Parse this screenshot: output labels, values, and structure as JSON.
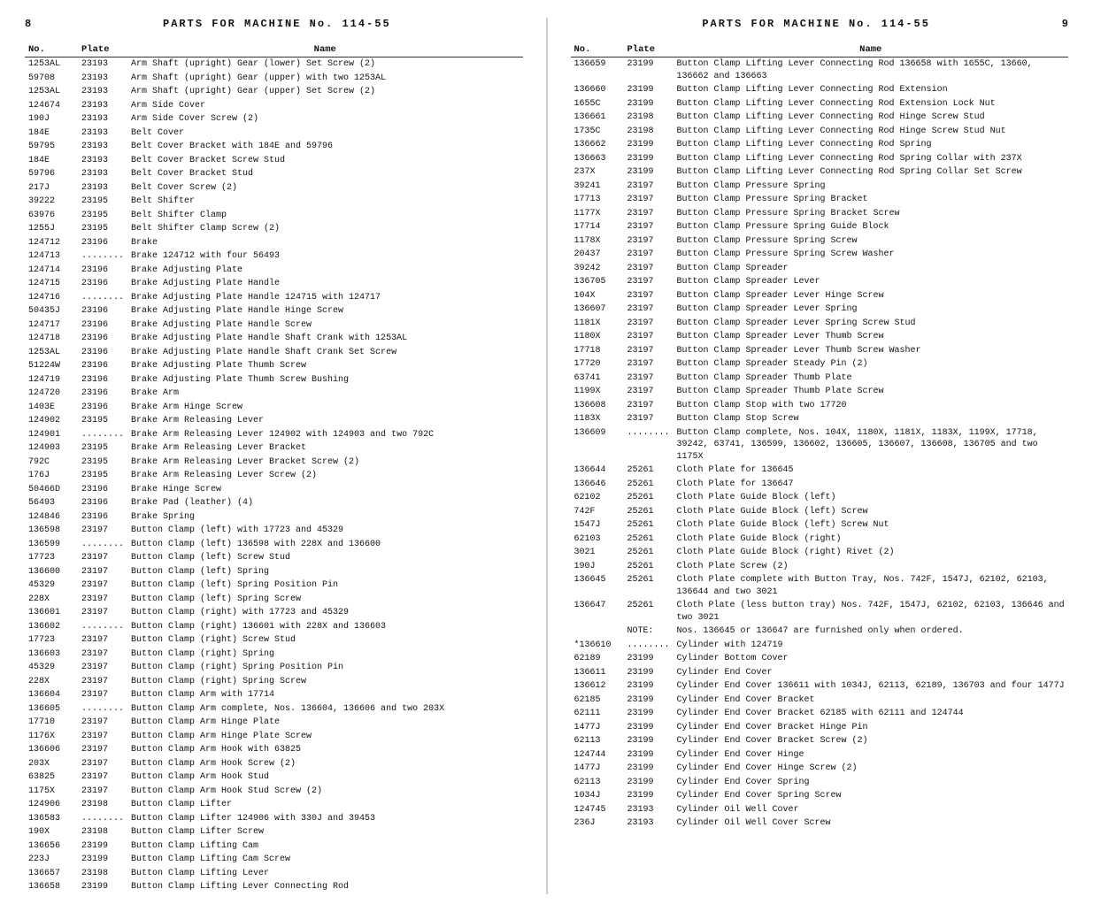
{
  "left_page": {
    "page_num": "8",
    "title": "PARTS  FOR  MACHINE  No.  114-55",
    "columns": [
      "No.",
      "Plate",
      "Name"
    ],
    "rows": [
      [
        "1253AL",
        "23193",
        "Arm Shaft (upright) Gear (lower) Set Screw (2)"
      ],
      [
        "59708",
        "23193",
        "Arm Shaft (upright) Gear (upper) with two 1253AL"
      ],
      [
        "1253AL",
        "23193",
        "Arm Shaft (upright) Gear (upper) Set Screw (2)"
      ],
      [
        "124674",
        "23193",
        "Arm Side Cover"
      ],
      [
        "190J",
        "23193",
        "Arm Side Cover Screw (2)"
      ],
      [
        "184E",
        "23193",
        "Belt Cover"
      ],
      [
        "59795",
        "23193",
        "Belt Cover Bracket with 184E and 59796"
      ],
      [
        "184E",
        "23193",
        "Belt Cover Bracket Screw Stud"
      ],
      [
        "59796",
        "23193",
        "Belt Cover Bracket Stud"
      ],
      [
        "217J",
        "23193",
        "Belt Cover Screw (2)"
      ],
      [
        "39222",
        "23195",
        "Belt Shifter"
      ],
      [
        "63976",
        "23195",
        "Belt Shifter Clamp"
      ],
      [
        "1255J",
        "23195",
        "Belt Shifter Clamp Screw (2)"
      ],
      [
        "124712",
        "23196",
        "Brake"
      ],
      [
        "124713",
        "........",
        "Brake 124712 with four 56493"
      ],
      [
        "124714",
        "23196",
        "Brake Adjusting Plate"
      ],
      [
        "124715",
        "23196",
        "Brake Adjusting Plate Handle"
      ],
      [
        "124716",
        "........",
        "Brake Adjusting Plate Handle 124715 with 124717"
      ],
      [
        "50435J",
        "23196",
        "Brake Adjusting Plate Handle Hinge Screw"
      ],
      [
        "124717",
        "23196",
        "Brake Adjusting Plate Handle Screw"
      ],
      [
        "124718",
        "23196",
        "Brake Adjusting Plate Handle Shaft Crank with 1253AL"
      ],
      [
        "1253AL",
        "23196",
        "Brake Adjusting Plate Handle Shaft Crank Set Screw"
      ],
      [
        "51224W",
        "23196",
        "Brake Adjusting Plate Thumb Screw"
      ],
      [
        "124719",
        "23196",
        "Brake Adjusting Plate Thumb Screw Bushing"
      ],
      [
        "124720",
        "23196",
        "Brake Arm"
      ],
      [
        "1403E",
        "23196",
        "Brake Arm Hinge Screw"
      ],
      [
        "124902",
        "23195",
        "Brake Arm Releasing Lever"
      ],
      [
        "124901",
        "........",
        "Brake Arm Releasing Lever 124902 with 124903 and two 792C"
      ],
      [
        "124903",
        "23195",
        "Brake Arm Releasing Lever Bracket"
      ],
      [
        "792C",
        "23195",
        "Brake Arm Releasing Lever Bracket Screw (2)"
      ],
      [
        "176J",
        "23195",
        "Brake Arm Releasing Lever Screw (2)"
      ],
      [
        "50466D",
        "23196",
        "Brake Hinge Screw"
      ],
      [
        "56493",
        "23196",
        "Brake Pad (leather) (4)"
      ],
      [
        "124846",
        "23196",
        "Brake Spring"
      ],
      [
        "136598",
        "23197",
        "Button Clamp (left) with 17723 and 45329"
      ],
      [
        "136599",
        "........",
        "Button Clamp (left) 136598 with 228X and 136600"
      ],
      [
        "17723",
        "23197",
        "Button Clamp (left) Screw Stud"
      ],
      [
        "136600",
        "23197",
        "Button Clamp (left) Spring"
      ],
      [
        "45329",
        "23197",
        "Button Clamp (left) Spring Position Pin"
      ],
      [
        "228X",
        "23197",
        "Button Clamp (left) Spring Screw"
      ],
      [
        "136601",
        "23197",
        "Button Clamp (right) with 17723 and 45329"
      ],
      [
        "136602",
        "........",
        "Button Clamp (right) 136601 with 228X and 136603"
      ],
      [
        "17723",
        "23197",
        "Button Clamp (right) Screw Stud"
      ],
      [
        "136603",
        "23197",
        "Button Clamp (right) Spring"
      ],
      [
        "45329",
        "23197",
        "Button Clamp (right) Spring Position Pin"
      ],
      [
        "228X",
        "23197",
        "Button Clamp (right) Spring Screw"
      ],
      [
        "136604",
        "23197",
        "Button Clamp Arm with 17714"
      ],
      [
        "136605",
        "........",
        "Button Clamp Arm complete, Nos. 136604, 136606 and two 203X"
      ],
      [
        "17710",
        "23197",
        "Button Clamp Arm Hinge Plate"
      ],
      [
        "1176X",
        "23197",
        "Button Clamp Arm Hinge Plate Screw"
      ],
      [
        "136606",
        "23197",
        "Button Clamp Arm Hook with 63825"
      ],
      [
        "203X",
        "23197",
        "Button Clamp Arm Hook Screw (2)"
      ],
      [
        "63825",
        "23197",
        "Button Clamp Arm Hook Stud"
      ],
      [
        "1175X",
        "23197",
        "Button Clamp Arm Hook Stud Screw (2)"
      ],
      [
        "124906",
        "23198",
        "Button Clamp Lifter"
      ],
      [
        "136583",
        "........",
        "Button Clamp Lifter 124906 with 330J and 39453"
      ],
      [
        "190X",
        "23198",
        "Button Clamp Lifter Screw"
      ],
      [
        "136656",
        "23199",
        "Button Clamp Lifting Cam"
      ],
      [
        "223J",
        "23199",
        "Button Clamp Lifting Cam Screw"
      ],
      [
        "136657",
        "23198",
        "Button Clamp Lifting Lever"
      ],
      [
        "136658",
        "23199",
        "Button Clamp Lifting Lever Connecting Rod"
      ]
    ]
  },
  "right_page": {
    "page_num": "9",
    "title": "PARTS  FOR  MACHINE  No.  114-55",
    "columns": [
      "No.",
      "Plate",
      "Name"
    ],
    "rows": [
      [
        "136659",
        "23199",
        "Button Clamp Lifting Lever Connecting Rod 136658 with 1655C, 13660, 136662 and 136663"
      ],
      [
        "136660",
        "23199",
        "Button Clamp Lifting Lever Connecting Rod Extension"
      ],
      [
        "1655C",
        "23199",
        "Button Clamp Lifting Lever Connecting Rod Extension Lock Nut"
      ],
      [
        "136661",
        "23198",
        "Button Clamp Lifting Lever Connecting Rod Hinge Screw Stud"
      ],
      [
        "1735C",
        "23198",
        "Button Clamp Lifting Lever Connecting Rod Hinge Screw Stud Nut"
      ],
      [
        "136662",
        "23199",
        "Button Clamp Lifting Lever Connecting Rod Spring"
      ],
      [
        "136663",
        "23199",
        "Button Clamp Lifting Lever Connecting Rod Spring Collar with 237X"
      ],
      [
        "237X",
        "23199",
        "Button Clamp Lifting Lever Connecting Rod Spring Collar Set Screw"
      ],
      [
        "39241",
        "23197",
        "Button Clamp Pressure Spring"
      ],
      [
        "17713",
        "23197",
        "Button Clamp Pressure Spring Bracket"
      ],
      [
        "1177X",
        "23197",
        "Button Clamp Pressure Spring Bracket Screw"
      ],
      [
        "17714",
        "23197",
        "Button Clamp Pressure Spring Guide Block"
      ],
      [
        "1178X",
        "23197",
        "Button Clamp Pressure Spring Screw"
      ],
      [
        "20437",
        "23197",
        "Button Clamp Pressure Spring Screw Washer"
      ],
      [
        "39242",
        "23197",
        "Button Clamp Spreader"
      ],
      [
        "136705",
        "23197",
        "Button Clamp Spreader Lever"
      ],
      [
        "104X",
        "23197",
        "Button Clamp Spreader Lever Hinge Screw"
      ],
      [
        "136607",
        "23197",
        "Button Clamp Spreader Lever Spring"
      ],
      [
        "1181X",
        "23197",
        "Button Clamp Spreader Lever Spring Screw Stud"
      ],
      [
        "1180X",
        "23197",
        "Button Clamp Spreader Lever Thumb Screw"
      ],
      [
        "17718",
        "23197",
        "Button Clamp Spreader Lever Thumb Screw Washer"
      ],
      [
        "17720",
        "23197",
        "Button Clamp Spreader Steady Pin (2)"
      ],
      [
        "63741",
        "23197",
        "Button Clamp Spreader Thumb Plate"
      ],
      [
        "1199X",
        "23197",
        "Button Clamp Spreader Thumb Plate Screw"
      ],
      [
        "136608",
        "23197",
        "Button Clamp Stop with two 17720"
      ],
      [
        "1183X",
        "23197",
        "Button Clamp Stop Screw"
      ],
      [
        "136609",
        "........",
        "Button Clamp complete, Nos. 104X, 1180X, 1181X, 1183X, 1199X, 17718, 39242, 63741, 136599, 136602, 136605, 136607, 136608, 136705 and two 1175X"
      ],
      [
        "136644",
        "25261",
        "Cloth Plate for 136645"
      ],
      [
        "136646",
        "25261",
        "Cloth Plate for 136647"
      ],
      [
        "62102",
        "25261",
        "Cloth Plate Guide Block (left)"
      ],
      [
        "742F",
        "25261",
        "Cloth Plate Guide Block (left) Screw"
      ],
      [
        "1547J",
        "25261",
        "Cloth Plate Guide Block (left) Screw Nut"
      ],
      [
        "62103",
        "25261",
        "Cloth Plate Guide Block (right)"
      ],
      [
        "3021",
        "25261",
        "Cloth Plate Guide Block (right) Rivet (2)"
      ],
      [
        "190J",
        "25261",
        "Cloth Plate Screw (2)"
      ],
      [
        "136645",
        "25261",
        "Cloth Plate complete with Button Tray, Nos. 742F, 1547J, 62102, 62103, 136644 and two 3021"
      ],
      [
        "136647",
        "25261",
        "Cloth Plate (less button tray) Nos. 742F, 1547J, 62102, 62103, 136646 and two 3021"
      ],
      [
        "",
        "NOTE:",
        "Nos. 136645 or 136647 are furnished only when ordered."
      ],
      [
        "*136610",
        "........",
        "Cylinder with 124719"
      ],
      [
        "62189",
        "23199",
        "Cylinder Bottom Cover"
      ],
      [
        "136611",
        "23199",
        "Cylinder End Cover"
      ],
      [
        "136612",
        "23199",
        "Cylinder End Cover 136611 with 1034J, 62113, 62189, 136703 and four 1477J"
      ],
      [
        "62185",
        "23199",
        "Cylinder End Cover Bracket"
      ],
      [
        "62111",
        "23199",
        "Cylinder End Cover Bracket 62185 with 62111 and 124744"
      ],
      [
        "1477J",
        "23199",
        "Cylinder End Cover Bracket Hinge Pin"
      ],
      [
        "62113",
        "23199",
        "Cylinder End Cover Bracket Screw (2)"
      ],
      [
        "124744",
        "23199",
        "Cylinder End Cover Hinge"
      ],
      [
        "1477J",
        "23199",
        "Cylinder End Cover Hinge Screw (2)"
      ],
      [
        "62113",
        "23199",
        "Cylinder End Cover Spring"
      ],
      [
        "1034J",
        "23199",
        "Cylinder End Cover Spring Screw"
      ],
      [
        "124745",
        "23193",
        "Cylinder Oil Well Cover"
      ],
      [
        "236J",
        "23193",
        "Cylinder Oil Well Cover Screw"
      ]
    ]
  }
}
